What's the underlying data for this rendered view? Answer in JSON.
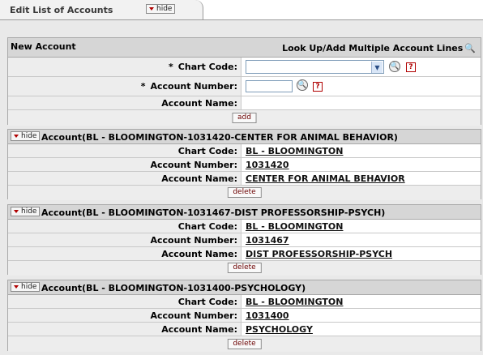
{
  "tab": {
    "title": "Edit List of Accounts",
    "hide_label": "hide"
  },
  "new_account": {
    "header": "New Account",
    "lookup_multiple": "Look Up/Add Multiple Account Lines",
    "chart_code_label": "Chart Code:",
    "account_number_label": "Account Number:",
    "account_name_label": "Account Name:",
    "required_marker": "*",
    "chart_code_value": "",
    "account_number_value": "",
    "add_label": "add"
  },
  "labels": {
    "chart_code": "Chart Code:",
    "account_number": "Account Number:",
    "account_name": "Account Name:",
    "delete": "delete",
    "hide": "hide"
  },
  "accounts": [
    {
      "title": "Account(BL - BLOOMINGTON-1031420-CENTER FOR ANIMAL BEHAVIOR)",
      "chart_code": "BL - BLOOMINGTON",
      "account_number": "1031420",
      "account_name": "CENTER FOR ANIMAL BEHAVIOR"
    },
    {
      "title": "Account(BL - BLOOMINGTON-1031467-DIST PROFESSORSHIP-PSYCH)",
      "chart_code": "BL - BLOOMINGTON",
      "account_number": "1031467",
      "account_name": "DIST PROFESSORSHIP-PSYCH"
    },
    {
      "title": "Account(BL - BLOOMINGTON-1031400-PSYCHOLOGY)",
      "chart_code": "BL - BLOOMINGTON",
      "account_number": "1031400",
      "account_name": "PSYCHOLOGY"
    }
  ]
}
